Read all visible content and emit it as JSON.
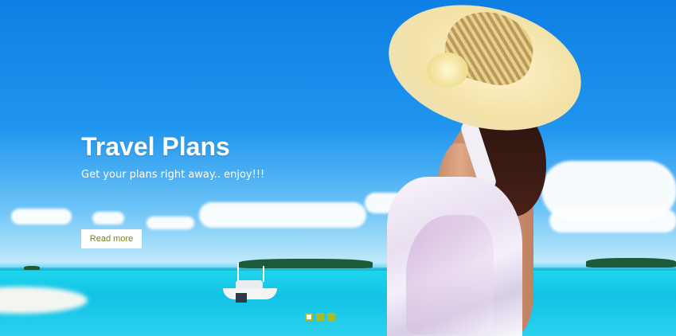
{
  "slide": {
    "title": "Travel Plans",
    "subtitle": "Get your plans right away.. enjoy!!!",
    "button_label": "Read more"
  },
  "pager": {
    "count": 3,
    "active_index": 0
  },
  "colors": {
    "sky": "#1f95ef",
    "sea": "#1cc6e6",
    "accent": "#a6bd2a",
    "button_text": "#6e8a1e",
    "title": "#ffffff"
  }
}
